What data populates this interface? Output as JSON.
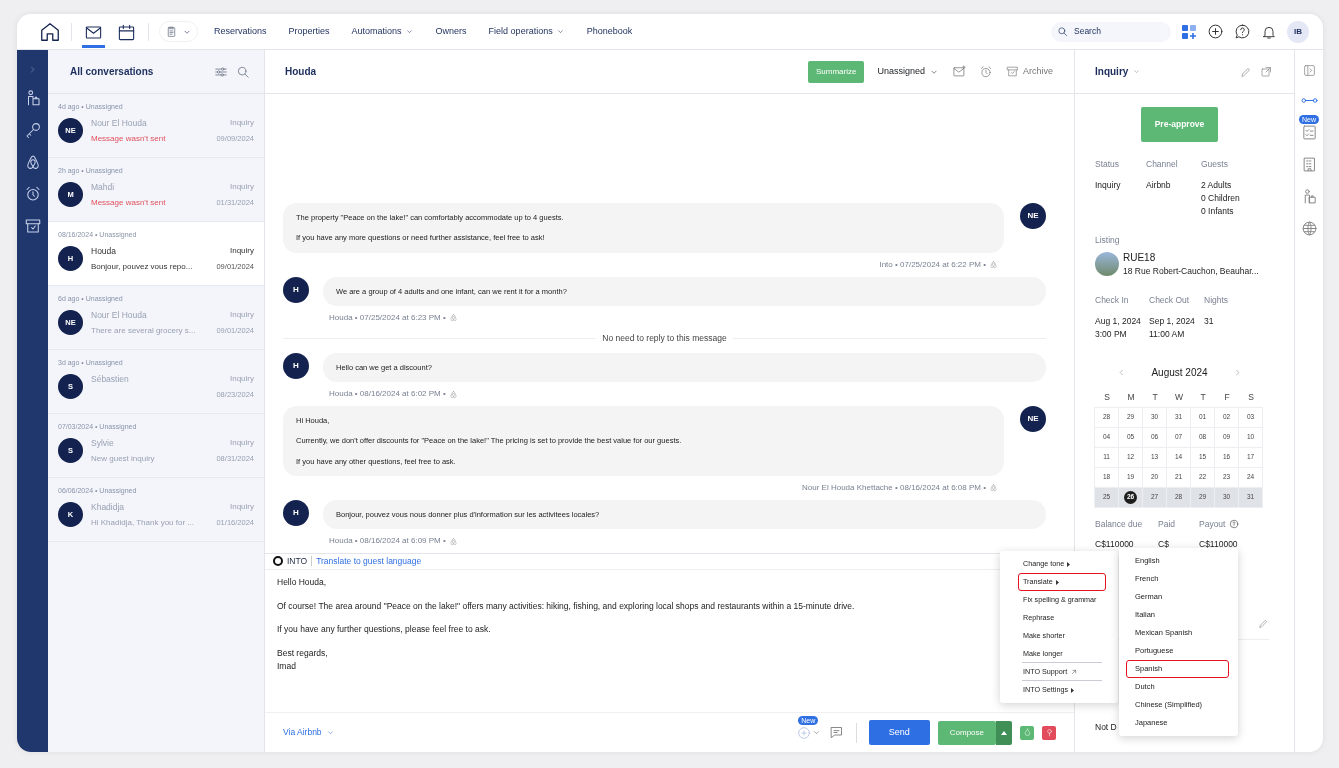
{
  "nav": {
    "apps": [
      {
        "selected": true
      },
      {
        "selected": false
      }
    ],
    "links": [
      {
        "label": "Reservations",
        "dropdown": false
      },
      {
        "label": "Properties",
        "dropdown": false
      },
      {
        "label": "Automations",
        "dropdown": true
      },
      {
        "label": "Owners",
        "dropdown": false
      },
      {
        "label": "Field operations",
        "dropdown": true
      },
      {
        "label": "Phonebook",
        "dropdown": false
      }
    ],
    "search": {
      "placeholder": "Search"
    },
    "avatar": "IB"
  },
  "list": {
    "title": "All conversations",
    "items": [
      {
        "meta": "4d ago • Unassigned",
        "initials": "NE",
        "name": "Nour El Houda",
        "status": "Inquiry",
        "preview": "Message wasn't sent",
        "error": true,
        "date": "09/09/2024",
        "selected": false
      },
      {
        "meta": "2h ago • Unassigned",
        "initials": "M",
        "name": "Mahdi",
        "status": "Inquiry",
        "preview": "Message wasn't sent",
        "error": true,
        "date": "01/31/2024",
        "selected": false
      },
      {
        "meta": "08/16/2024 • Unassigned",
        "initials": "H",
        "name": "Houda",
        "status": "Inquiry",
        "preview": "Bonjour, pouvez vous repo...",
        "error": false,
        "date": "09/01/2024",
        "selected": true
      },
      {
        "meta": "6d ago • Unassigned",
        "initials": "NE",
        "name": "Nour El Houda",
        "status": "Inquiry",
        "preview": "There are several grocery s...",
        "error": false,
        "date": "09/01/2024",
        "selected": false
      },
      {
        "meta": "3d ago • Unassigned",
        "initials": "S",
        "name": "Sébastien",
        "status": "Inquiry",
        "date": "08/23/2024",
        "selected": false
      },
      {
        "meta": "07/03/2024 • Unassigned",
        "initials": "S",
        "name": "Sylvie",
        "status": "Inquiry",
        "preview": "New guest inquiry",
        "error": false,
        "date": "08/31/2024",
        "selected": false
      },
      {
        "meta": "06/06/2024 • Unassigned",
        "initials": "K",
        "name": "Khadidja",
        "status": "Inquiry",
        "preview": "Hi Khadidja, Thank you for ...",
        "error": false,
        "date": "01/16/2024",
        "selected": false
      }
    ]
  },
  "conversation": {
    "title": "Houda",
    "summarize": "Summarize",
    "assignee": "Unassigned",
    "archive": "Archive",
    "messages": [
      {
        "kind": "host",
        "avatar": "NE",
        "paragraphs": [
          "The property \"Peace on the lake!\" can comfortably accommodate up to 4 guests.",
          "If you have any more questions or need further assistance, feel free to ask!"
        ],
        "meta": "Into • 07/25/2024 at 6:22 PM •"
      },
      {
        "kind": "guest",
        "avatar": "H",
        "paragraphs": [
          "We are a group of 4 adults and one infant, can we rent it for a month?"
        ],
        "meta": "Houda • 07/25/2024 at 6:23 PM •"
      },
      {
        "kind": "notice",
        "text": "No need to reply to this message"
      },
      {
        "kind": "guest",
        "avatar": "H",
        "paragraphs": [
          "Hello can we get a discount?"
        ],
        "meta": "Houda • 08/16/2024 at 6:02 PM •"
      },
      {
        "kind": "host",
        "avatar": "NE",
        "paragraphs": [
          "Hi Houda,",
          "Currently, we don't offer discounts for \"Peace on the lake!\" The pricing is set to provide the best value for our guests.",
          "If you have any other questions, feel free to ask."
        ],
        "meta": "Nour El Houda Khettache • 08/16/2024 at 6:08 PM •"
      },
      {
        "kind": "guest",
        "avatar": "H",
        "paragraphs": [
          "Bonjour, pouvez vous nous donner plus d'information sur les activitees locales?"
        ],
        "meta": "Houda • 08/16/2024 at 6:09 PM •"
      }
    ]
  },
  "composer": {
    "toggle": "INTO",
    "translate_link": "Translate to guest language",
    "paragraphs": [
      [
        "Hello Houda,"
      ],
      [
        "Of course! The area around \"Peace on the lake!\" offers many activities: hiking, fishing, and exploring local shops and restaurants within a 15-minute drive."
      ],
      [
        "If you have any further questions, please feel free to ask."
      ],
      [
        "Best regards,",
        "Imad"
      ]
    ],
    "channel": "Via Airbnb",
    "new_badge": "New",
    "send": "Send",
    "compose": "Compose"
  },
  "ai_menu": {
    "items": [
      {
        "label": "Change tone",
        "submenu": true,
        "external": false,
        "separated": false,
        "highlighted": false
      },
      {
        "label": "Translate",
        "submenu": true,
        "external": false,
        "separated": false,
        "highlighted": true
      },
      {
        "label": "Fix spelling & grammar",
        "submenu": false,
        "external": false,
        "separated": false,
        "highlighted": false
      },
      {
        "label": "Rephrase",
        "submenu": false,
        "external": false,
        "separated": false,
        "highlighted": false
      },
      {
        "label": "Make shorter",
        "submenu": false,
        "external": false,
        "separated": false,
        "highlighted": false
      },
      {
        "label": "Make longer",
        "submenu": false,
        "external": false,
        "separated": false,
        "highlighted": false
      },
      {
        "label": "INTO Support",
        "submenu": false,
        "external": true,
        "separated": true,
        "highlighted": false
      },
      {
        "label": "INTO Settings",
        "submenu": true,
        "external": false,
        "separated": true,
        "highlighted": false
      }
    ]
  },
  "languages": [
    {
      "label": "English",
      "highlighted": false
    },
    {
      "label": "French",
      "highlighted": false
    },
    {
      "label": "German",
      "highlighted": false
    },
    {
      "label": "Italian",
      "highlighted": false
    },
    {
      "label": "Mexican Spanish",
      "highlighted": false
    },
    {
      "label": "Portuguese",
      "highlighted": false
    },
    {
      "label": "Spanish",
      "highlighted": true
    },
    {
      "label": "Dutch",
      "highlighted": false
    },
    {
      "label": "Chinese (Simplified)",
      "highlighted": false
    },
    {
      "label": "Japanese",
      "highlighted": false
    }
  ],
  "details": {
    "title": "Inquiry",
    "preapprove": "Pre-approve",
    "fields": [
      {
        "label": "Status",
        "lines": [
          "Inquiry"
        ]
      },
      {
        "label": "Channel",
        "lines": [
          "Airbnb"
        ]
      },
      {
        "label": "Guests",
        "lines": [
          "2 Adults",
          "0 Children",
          "0 Infants"
        ]
      }
    ],
    "listing_label": "Listing",
    "listing": {
      "name": "RUE18",
      "address": "18 Rue Robert-Cauchon, Beauhar..."
    },
    "stay": [
      {
        "label": "Check In",
        "lines": [
          "Aug 1, 2024",
          "3:00 PM"
        ]
      },
      {
        "label": "Check Out",
        "lines": [
          "Sep 1, 2024",
          "11:00 AM"
        ]
      },
      {
        "label": "Nights",
        "lines": [
          "31"
        ]
      }
    ],
    "calendar": {
      "month": "August 2024",
      "weekdays": [
        "S",
        "M",
        "T",
        "W",
        "T",
        "F",
        "S"
      ],
      "weeks": [
        {
          "highlighted": false,
          "days": [
            {
              "label": "28",
              "selected": false
            },
            {
              "label": "29",
              "selected": false
            },
            {
              "label": "30",
              "selected": false
            },
            {
              "label": "31",
              "selected": false
            },
            {
              "label": "01",
              "selected": false
            },
            {
              "label": "02",
              "selected": false
            },
            {
              "label": "03",
              "selected": false
            }
          ]
        },
        {
          "highlighted": false,
          "days": [
            {
              "label": "04",
              "selected": false
            },
            {
              "label": "05",
              "selected": false
            },
            {
              "label": "06",
              "selected": false
            },
            {
              "label": "07",
              "selected": false
            },
            {
              "label": "08",
              "selected": false
            },
            {
              "label": "09",
              "selected": false
            },
            {
              "label": "10",
              "selected": false
            }
          ]
        },
        {
          "highlighted": false,
          "days": [
            {
              "label": "11",
              "selected": false
            },
            {
              "label": "12",
              "selected": false
            },
            {
              "label": "13",
              "selected": false
            },
            {
              "label": "14",
              "selected": false
            },
            {
              "label": "15",
              "selected": false
            },
            {
              "label": "16",
              "selected": false
            },
            {
              "label": "17",
              "selected": false
            }
          ]
        },
        {
          "highlighted": false,
          "days": [
            {
              "label": "18",
              "selected": false
            },
            {
              "label": "19",
              "selected": false
            },
            {
              "label": "20",
              "selected": false
            },
            {
              "label": "21",
              "selected": false
            },
            {
              "label": "22",
              "selected": false
            },
            {
              "label": "23",
              "selected": false
            },
            {
              "label": "24",
              "selected": false
            }
          ]
        },
        {
          "highlighted": true,
          "days": [
            {
              "label": "25",
              "selected": false
            },
            {
              "label": "26",
              "selected": true
            },
            {
              "label": "27",
              "selected": false
            },
            {
              "label": "28",
              "selected": false
            },
            {
              "label": "29",
              "selected": false
            },
            {
              "label": "30",
              "selected": false
            },
            {
              "label": "31",
              "selected": false
            }
          ]
        }
      ]
    },
    "payments": [
      {
        "label": "Balance due",
        "value": "C$110000",
        "help": false
      },
      {
        "label": "Paid",
        "value": "C$",
        "help": false
      },
      {
        "label": "Payout",
        "value": "C$110000",
        "help": true
      }
    ],
    "note": "Not D"
  },
  "right_rail": {
    "badge": "New"
  }
}
